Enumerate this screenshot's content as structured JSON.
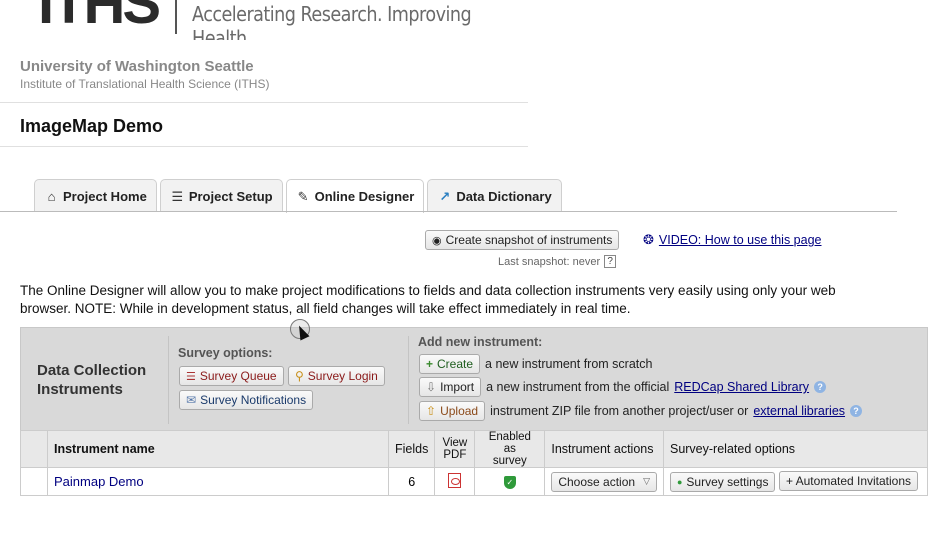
{
  "brand": {
    "logo_text": "ITHS",
    "tagline": "Accelerating Research. Improving Health."
  },
  "institution": {
    "name": "University of Washington Seattle",
    "subtitle": "Institute of Translational Health Science (ITHS)"
  },
  "project": {
    "title": "ImageMap Demo"
  },
  "tabs": [
    {
      "label": "Project Home",
      "icon": "home-icon"
    },
    {
      "label": "Project Setup",
      "icon": "checklist-icon"
    },
    {
      "label": "Online Designer",
      "icon": "designer-icon",
      "active": true
    },
    {
      "label": "Data Dictionary",
      "icon": "dictionary-icon"
    }
  ],
  "snapshot": {
    "button_label": "Create snapshot of instruments",
    "last_snapshot": "Last snapshot: never",
    "help": "?"
  },
  "video_link": "VIDEO: How to use this page",
  "intro_text": "The Online Designer will allow you to make project modifications to fields and data collection instruments very easily using only your web browser. NOTE: While in development status, all field changes will take effect immediately in real time.",
  "panel": {
    "title_line1": "Data Collection",
    "title_line2": "Instruments",
    "survey_options_label": "Survey options:",
    "survey_queue": "Survey Queue",
    "survey_login": "Survey Login",
    "survey_notifications": "Survey Notifications",
    "add_label": "Add new instrument:",
    "create_button": "Create",
    "create_text": "a new instrument from scratch",
    "import_button": "Import",
    "import_text": "a new instrument from the official",
    "import_link": "REDCap Shared Library",
    "upload_button": "Upload",
    "upload_text": "instrument ZIP file from another project/user or",
    "upload_link": "external libraries"
  },
  "table": {
    "headers": {
      "name": "Instrument name",
      "fields": "Fields",
      "view_pdf_1": "View",
      "view_pdf_2": "PDF",
      "enabled_1": "Enabled as",
      "enabled_2": "survey",
      "actions": "Instrument actions",
      "survey_options": "Survey-related options"
    },
    "rows": [
      {
        "name": "Painmap Demo",
        "fields": "6",
        "action_button": "Choose action",
        "survey_settings": "Survey settings",
        "automated_invitations": "+ Automated Invitations"
      }
    ]
  }
}
